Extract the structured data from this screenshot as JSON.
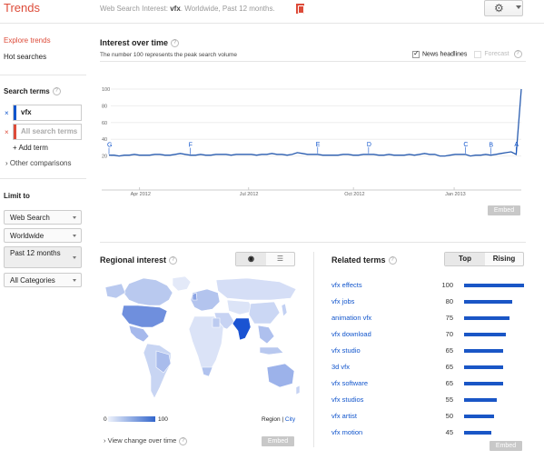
{
  "header": {
    "logo": "Trends",
    "crumb_prefix": "Web Search Interest: ",
    "crumb_term": "vfx",
    "crumb_suffix": ". Worldwide, Past 12 months.",
    "settings_icon": "gear-icon",
    "share_icon": "google-plus-icon"
  },
  "sidebar": {
    "explore": "Explore trends",
    "hot": "Hot searches",
    "search_terms_heading": "Search terms",
    "terms": [
      {
        "label": "vfx",
        "color": "#1155cc"
      },
      {
        "label": "All search terms",
        "color": "#dd4b39"
      }
    ],
    "add_term": "Add term",
    "other_comparisons": "Other comparisons",
    "limit_heading": "Limit to",
    "filters": [
      "Web Search",
      "Worldwide",
      "Past 12 months",
      "All Categories"
    ]
  },
  "interest": {
    "title": "Interest over time",
    "note": "The number 100 represents the peak search volume",
    "news_headlines": "News headlines",
    "forecast": "Forecast",
    "embed": "Embed"
  },
  "chart_data": {
    "type": "line",
    "ylim": [
      0,
      100
    ],
    "y_ticks": [
      20,
      40,
      60,
      80,
      100
    ],
    "x_tick_labels": [
      "Apr 2012",
      "Jul 2012",
      "Oct 2012",
      "Jan 2013"
    ],
    "series": [
      {
        "name": "vfx",
        "color": "#2a5db0",
        "values": [
          21,
          21,
          20,
          21,
          21,
          22,
          21,
          21,
          21,
          22,
          22,
          21,
          21,
          22,
          23,
          22,
          21,
          21,
          22,
          21,
          21,
          22,
          22,
          22,
          21,
          22,
          22,
          22,
          22,
          21,
          22,
          22,
          23,
          22,
          22,
          21,
          22,
          24,
          23,
          22,
          22,
          22,
          21,
          21,
          21,
          21,
          22,
          22,
          21,
          21,
          22,
          22,
          22,
          21,
          21,
          22,
          21,
          21,
          21,
          22,
          21,
          22,
          23,
          22,
          22,
          20,
          20,
          21,
          22,
          22,
          22,
          20,
          21,
          21,
          22,
          21,
          22,
          23,
          24,
          25,
          22,
          100
        ]
      }
    ],
    "annotations": [
      "G",
      "F",
      "E",
      "D",
      "C",
      "B",
      "A"
    ],
    "annotation_color": "#1155cc"
  },
  "regional": {
    "title": "Regional interest",
    "map_icon": "globe-icon",
    "list_icon": "list-icon",
    "legend_min": "0",
    "legend_max": "100",
    "region": "Region",
    "city": "City",
    "view_change": "View change over time",
    "embed": "Embed"
  },
  "related": {
    "title": "Related terms",
    "tab_top": "Top",
    "tab_rising": "Rising",
    "embed": "Embed",
    "items": [
      {
        "term": "vfx effects",
        "value": 100
      },
      {
        "term": "vfx jobs",
        "value": 80
      },
      {
        "term": "animation vfx",
        "value": 75
      },
      {
        "term": "vfx download",
        "value": 70
      },
      {
        "term": "vfx studio",
        "value": 65
      },
      {
        "term": "3d vfx",
        "value": 65
      },
      {
        "term": "vfx software",
        "value": 65
      },
      {
        "term": "vfx studios",
        "value": 55
      },
      {
        "term": "vfx artist",
        "value": 50
      },
      {
        "term": "vfx motion",
        "value": 45
      }
    ]
  }
}
